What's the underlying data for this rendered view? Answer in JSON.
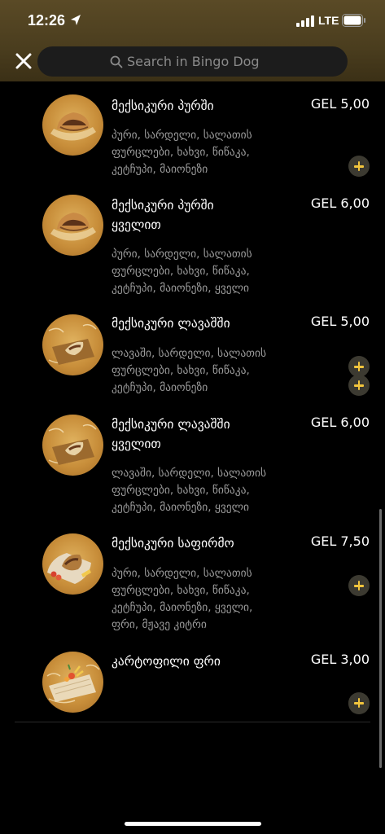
{
  "status_bar": {
    "time": "12:26",
    "network": "LTE",
    "location_icon": "location-arrow-icon",
    "signal_icon": "cellular-signal-icon",
    "battery_icon": "battery-icon"
  },
  "header": {
    "close_icon": "close-icon",
    "search": {
      "icon": "search-icon",
      "placeholder": "Search in Bingo Dog",
      "value": ""
    }
  },
  "colors": {
    "header_bg": "#4a3d1e",
    "accent": "#f2c53d",
    "text_primary": "#ffffff",
    "text_secondary": "#9a9a9a",
    "background": "#000000"
  },
  "menu_items": [
    {
      "name_line1": "მექსიკური პურში",
      "name_line2": "",
      "price": "GEL 5,00",
      "desc": [
        "პური, სარდელი, სალათის",
        "ფურცლები, ხახვი, წიწაკა,",
        "კეტჩუპი, მაიონეზი"
      ],
      "image": "bread-sandwich-image"
    },
    {
      "name_line1": "მექსიკური პურში",
      "name_line2": "ყველით",
      "price": "GEL 6,00",
      "desc": [
        "პური, სარდელი, სალათის",
        "ფურცლები, ხახვი, წიწაკა,",
        "კეტჩუპი, მაიონეზი, ყველი"
      ],
      "image": "bread-sandwich-image"
    },
    {
      "name_line1": "მექსიკური ლავაშში",
      "name_line2": "",
      "price": "GEL 5,00",
      "desc": [
        "ლავაში, სარდელი, სალათის",
        "ფურცლები, ხახვი, წიწაკა,",
        "კეტჩუპი, მაიონეზი"
      ],
      "image": "lavash-wrap-image"
    },
    {
      "name_line1": "მექსიკური ლავაშში",
      "name_line2": "ყველით",
      "price": "GEL 6,00",
      "desc": [
        "ლავაში, სარდელი, სალათის",
        "ფურცლები, ხახვი, წიწაკა,",
        "კეტჩუპი, მაიონეზი, ყველი"
      ],
      "image": "lavash-wrap-image"
    },
    {
      "name_line1": "მექსიკური საფირმო",
      "name_line2": "",
      "price": "GEL 7,50",
      "desc": [
        "პური, სარდელი, სალათის",
        "ფურცლები, ხახვი, წიწაკა,",
        "კეტჩუპი, მაიონეზი, ყველი,",
        "ფრი, მჟავე კიტრი"
      ],
      "image": "signature-plate-image"
    },
    {
      "name_line1": "კარტოფილი ფრი",
      "name_line2": "",
      "price": "GEL 3,00",
      "desc": [],
      "image": "fries-image"
    }
  ],
  "add_button_icon": "plus-icon"
}
